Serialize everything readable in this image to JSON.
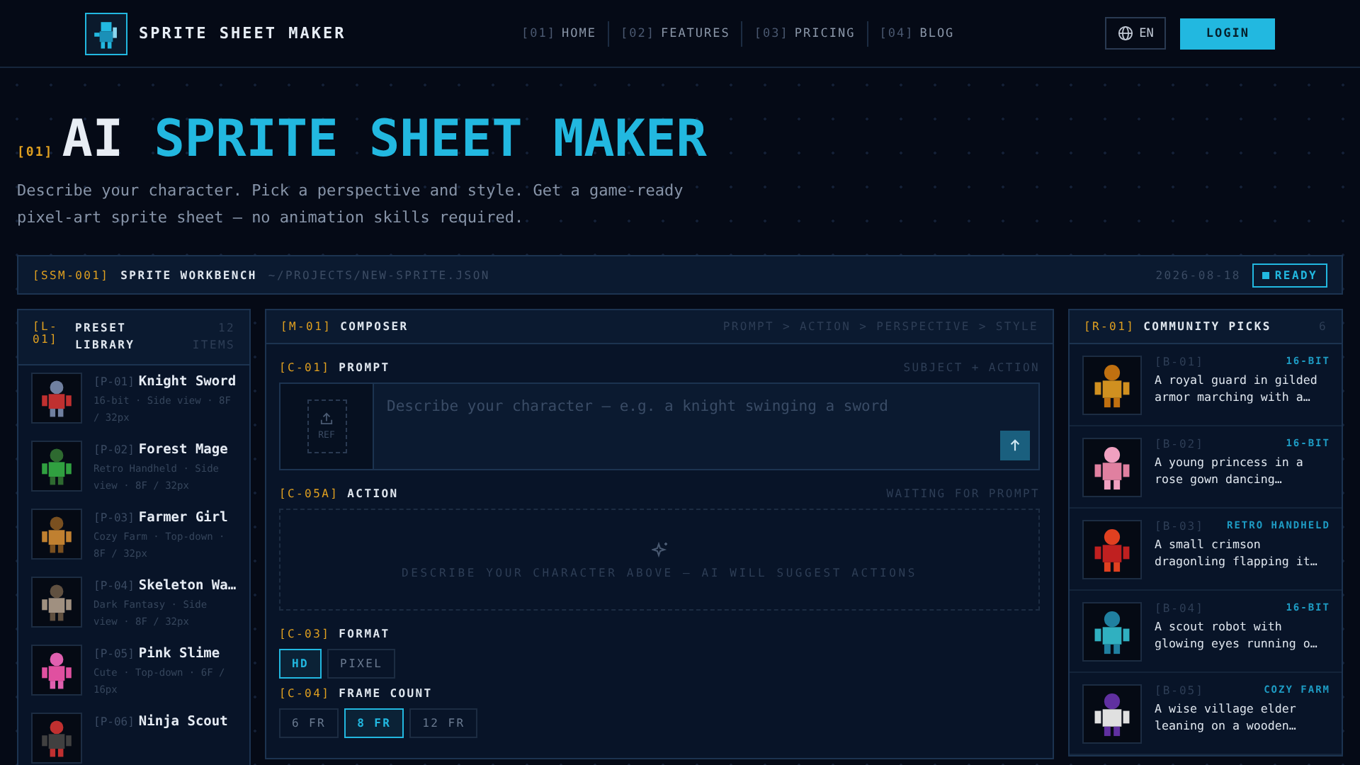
{
  "header": {
    "brand": "SPRITE SHEET MAKER",
    "nav": [
      {
        "num": "[01]",
        "label": "HOME"
      },
      {
        "num": "[02]",
        "label": "FEATURES"
      },
      {
        "num": "[03]",
        "label": "PRICING"
      },
      {
        "num": "[04]",
        "label": "BLOG"
      }
    ],
    "language": "EN",
    "login": "LOGIN"
  },
  "hero": {
    "index": "[01]",
    "title_lead": "AI",
    "title_main": "SPRITE SHEET MAKER",
    "description": "Describe your character. Pick a perspective and style. Get a game-ready pixel-art sprite sheet — no animation skills required."
  },
  "workbench": {
    "id": "[SSM-001]",
    "title": "SPRITE WORKBENCH",
    "path": "~/PROJECTS/NEW-SPRITE.JSON",
    "date": "2026-08-18",
    "status": "READY"
  },
  "library": {
    "id": "[L-01]",
    "title": "PRESET LIBRARY",
    "count": "12 ITEMS",
    "items": [
      {
        "id": "[P-01]",
        "name": "Knight Sword",
        "meta": "16-bit · Side view · 8F / 32px"
      },
      {
        "id": "[P-02]",
        "name": "Forest Mage",
        "meta": "Retro Handheld · Side view · 8F / 32px"
      },
      {
        "id": "[P-03]",
        "name": "Farmer Girl",
        "meta": "Cozy Farm · Top-down · 8F / 32px"
      },
      {
        "id": "[P-04]",
        "name": "Skeleton Wa…",
        "meta": "Dark Fantasy · Side view · 8F / 32px"
      },
      {
        "id": "[P-05]",
        "name": "Pink Slime",
        "meta": "Cute · Top-down · 6F / 16px"
      },
      {
        "id": "[P-06]",
        "name": "Ninja Scout"
      }
    ]
  },
  "composer": {
    "id": "[M-01]",
    "title": "COMPOSER",
    "steps": "PROMPT > ACTION > PERSPECTIVE > STYLE",
    "prompt": {
      "id": "[C-01]",
      "label": "PROMPT",
      "hint": "SUBJECT + ACTION",
      "ref": "REF",
      "placeholder": "Describe your character — e.g. a knight swinging a sword"
    },
    "action": {
      "id": "[C-05A]",
      "label": "ACTION",
      "hint": "WAITING FOR PROMPT",
      "empty": "DESCRIBE YOUR CHARACTER ABOVE — AI WILL SUGGEST ACTIONS"
    },
    "format": {
      "id": "[C-03]",
      "label": "FORMAT",
      "options": [
        {
          "label": "HD",
          "selected": true
        },
        {
          "label": "PIXEL",
          "selected": false
        }
      ]
    },
    "frames": {
      "id": "[C-04]",
      "label": "FRAME COUNT",
      "options": [
        {
          "label": "6 FR",
          "selected": false
        },
        {
          "label": "8 FR",
          "selected": true
        },
        {
          "label": "12 FR",
          "selected": false
        }
      ]
    }
  },
  "community": {
    "id": "[R-01]",
    "title": "COMMUNITY PICKS",
    "count": "6",
    "items": [
      {
        "id": "[B-01]",
        "tag": "16-BIT",
        "text": "A royal guard in gilded armor marching with a…"
      },
      {
        "id": "[B-02]",
        "tag": "16-BIT",
        "text": "A young princess in a rose gown dancing…"
      },
      {
        "id": "[B-03]",
        "tag": "RETRO HANDHELD",
        "text": "A small crimson dragonling flapping it…"
      },
      {
        "id": "[B-04]",
        "tag": "16-BIT",
        "text": "A scout robot with glowing eyes running o…"
      },
      {
        "id": "[B-05]",
        "tag": "COZY FARM",
        "text": "A wise village elder leaning on a wooden…"
      }
    ]
  }
}
